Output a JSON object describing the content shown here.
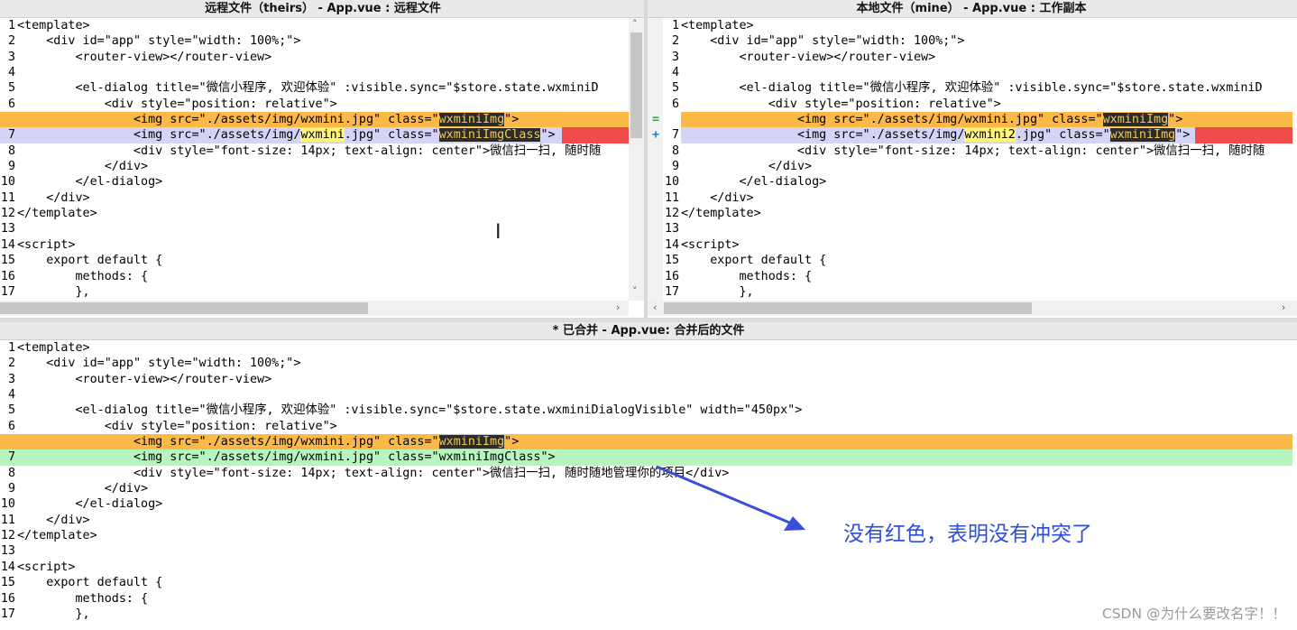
{
  "left_pane": {
    "title": "远程文件（theirs） - App.vue : 远程文件",
    "lines": [
      {
        "n": "1",
        "t": "<template>"
      },
      {
        "n": "2",
        "t": "    <div id=\"app\" style=\"width: 100%;\">"
      },
      {
        "n": "3",
        "t": "        <router-view></router-view>"
      },
      {
        "n": "4",
        "t": ""
      },
      {
        "n": "5",
        "t": "        <el-dialog title=\"微信小程序, 欢迎体验\" :visible.sync=\"$store.state.wxminiD"
      },
      {
        "n": "6",
        "t": "            <div style=\"position: relative\">"
      },
      {
        "n": "",
        "t": "                <img src=\"./assets/img/wxmini.jpg\" class=\"",
        "mark": "wxminiImg",
        "after": "\">"
      },
      {
        "n": "7",
        "t": "                <img src=\"./assets/img/",
        "mark2": "wxmini",
        "mid": ".jpg\" class=\"",
        "mark": "wxminiImgClass",
        "after": "\">"
      },
      {
        "n": "8",
        "t": "                <div style=\"font-size: 14px; text-align: center\">微信扫一扫, 随时随"
      },
      {
        "n": "9",
        "t": "            </div>"
      },
      {
        "n": "10",
        "t": "        </el-dialog>"
      },
      {
        "n": "11",
        "t": "    </div>"
      },
      {
        "n": "12",
        "t": "</template>"
      },
      {
        "n": "13",
        "t": ""
      },
      {
        "n": "14",
        "t": "<script>"
      },
      {
        "n": "15",
        "t": "    export default {"
      },
      {
        "n": "16",
        "t": "        methods: {"
      },
      {
        "n": "17",
        "t": "        },"
      }
    ]
  },
  "right_pane": {
    "title": "本地文件（mine） - App.vue : 工作副本",
    "gutter_equal": "=",
    "gutter_plus": "+",
    "lines": [
      {
        "n": "1",
        "t": "<template>"
      },
      {
        "n": "2",
        "t": "    <div id=\"app\" style=\"width: 100%;\">"
      },
      {
        "n": "3",
        "t": "        <router-view></router-view>"
      },
      {
        "n": "4",
        "t": ""
      },
      {
        "n": "5",
        "t": "        <el-dialog title=\"微信小程序, 欢迎体验\" :visible.sync=\"$store.state.wxminiD"
      },
      {
        "n": "6",
        "t": "            <div style=\"position: relative\">"
      },
      {
        "n": "",
        "t": "                <img src=\"./assets/img/wxmini.jpg\" class=\"",
        "mark": "wxminiImg",
        "after": "\">"
      },
      {
        "n": "7",
        "t": "                <img src=\"./assets/img/",
        "mark2": "wxmini2",
        "mid": ".jpg\" class=\"",
        "mark": "wxminiImg",
        "after": "\">"
      },
      {
        "n": "8",
        "t": "                <div style=\"font-size: 14px; text-align: center\">微信扫一扫, 随时随"
      },
      {
        "n": "9",
        "t": "            </div>"
      },
      {
        "n": "10",
        "t": "        </el-dialog>"
      },
      {
        "n": "11",
        "t": "    </div>"
      },
      {
        "n": "12",
        "t": "</template>"
      },
      {
        "n": "13",
        "t": ""
      },
      {
        "n": "14",
        "t": "<script>"
      },
      {
        "n": "15",
        "t": "    export default {"
      },
      {
        "n": "16",
        "t": "        methods: {"
      },
      {
        "n": "17",
        "t": "        },"
      }
    ]
  },
  "merged_pane": {
    "title": "* 已合并 - App.vue: 合并后的文件",
    "lines": [
      {
        "n": "1",
        "t": "<template>"
      },
      {
        "n": "2",
        "t": "    <div id=\"app\" style=\"width: 100%;\">"
      },
      {
        "n": "3",
        "t": "        <router-view></router-view>"
      },
      {
        "n": "4",
        "t": ""
      },
      {
        "n": "5",
        "t": "        <el-dialog title=\"微信小程序, 欢迎体验\" :visible.sync=\"$store.state.wxminiDialogVisible\" width=\"450px\">"
      },
      {
        "n": "6",
        "t": "            <div style=\"position: relative\">"
      },
      {
        "n": "",
        "t": "                <img src=\"./assets/img/wxmini.jpg\" class=\"",
        "mark": "wxminiImg",
        "after": "\">"
      },
      {
        "n": "7",
        "t": "                <img src=\"./assets/img/wxmini.jpg\" class=\"wxminiImgClass\">"
      },
      {
        "n": "8",
        "t": "                <div style=\"font-size: 14px; text-align: center\">微信扫一扫, 随时随地管理你的项目</div>"
      },
      {
        "n": "9",
        "t": "            </div>"
      },
      {
        "n": "10",
        "t": "        </el-dialog>"
      },
      {
        "n": "11",
        "t": "    </div>"
      },
      {
        "n": "12",
        "t": "</template>"
      },
      {
        "n": "13",
        "t": ""
      },
      {
        "n": "14",
        "t": "<script>"
      },
      {
        "n": "15",
        "t": "    export default {"
      },
      {
        "n": "16",
        "t": "        methods: {"
      },
      {
        "n": "17",
        "t": "        },"
      }
    ]
  },
  "annotation": {
    "text": "没有红色，表明没有冲突了",
    "color": "#2f4fd8"
  },
  "watermark": "CSDN @为什么要改名字！！",
  "colors": {
    "conflict_orange": "#fdb948",
    "theirs_lavender": "#d4d4f7",
    "merged_green": "#b6f5bd",
    "diff_red": "#ef4b4b",
    "marker_dark": "#2b2b2b",
    "marker_yellow": "#fff57a"
  },
  "icons": {
    "scroll_up": "chevron-up-icon",
    "scroll_down": "chevron-down-icon",
    "scroll_left": "chevron-left-icon",
    "scroll_right": "chevron-right-icon",
    "text_cursor": "ibeam-cursor-icon"
  },
  "glyphs": {
    "up": "˄",
    "down": "˅",
    "left": "‹",
    "right": "›",
    "ibeam": "I"
  }
}
